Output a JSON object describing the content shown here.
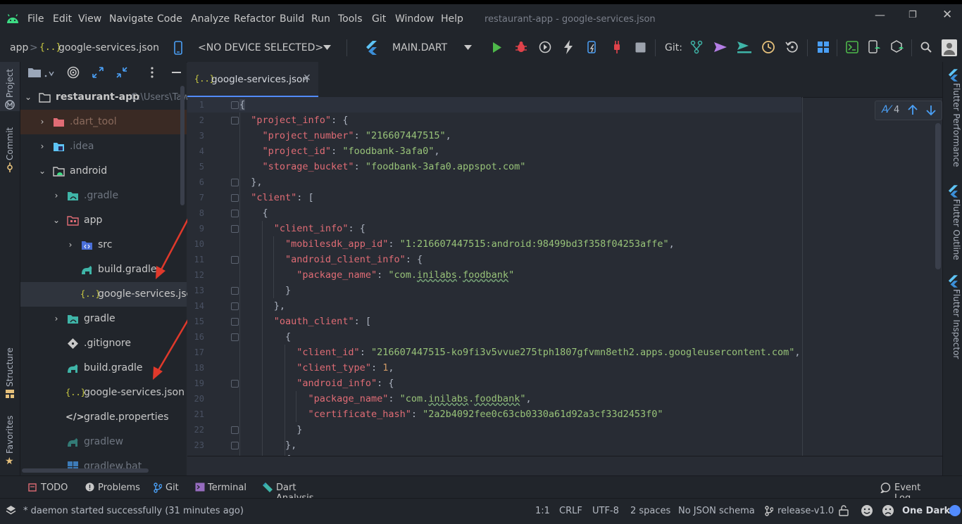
{
  "titlebar": {
    "menu": [
      "File",
      "Edit",
      "View",
      "Navigate",
      "Code",
      "Analyze",
      "Refactor",
      "Build",
      "Run",
      "Tools",
      "Git",
      "Window",
      "Help"
    ],
    "window_title": "restaurant-app - google-services.json"
  },
  "toolbar": {
    "breadcrumb_app": "app",
    "breadcrumb_sep": ">",
    "breadcrumb_file": "google-services.json",
    "json_icon": "{..}",
    "device": "<NO DEVICE SELECTED>",
    "run_config": "MAIN.DART",
    "git_label": "Git:"
  },
  "left_strip": {
    "project": "Project",
    "commit": "Commit",
    "structure": "Structure",
    "favorites": "Favorites"
  },
  "project_tree": {
    "root": "restaurant-app",
    "root_path": "C:\\Users\\Taw",
    "items": [
      {
        "label": "restaurant-app"
      },
      {
        "label": ".dart_tool"
      },
      {
        "label": ".idea"
      },
      {
        "label": "android"
      },
      {
        "label": ".gradle"
      },
      {
        "label": "app"
      },
      {
        "label": "src"
      },
      {
        "label": "build.gradle"
      },
      {
        "label": "google-services.json"
      },
      {
        "label": "gradle"
      },
      {
        "label": ".gitignore"
      },
      {
        "label": "build.gradle"
      },
      {
        "label": "google-services.json"
      },
      {
        "label": "gradle.properties"
      },
      {
        "label": "gradlew"
      },
      {
        "label": "gradlew.bat"
      }
    ]
  },
  "editor": {
    "tab_label": "google-services.json",
    "tab_icon": "{..}",
    "inspection_count": "4",
    "line_numbers": [
      "1",
      "2",
      "3",
      "4",
      "5",
      "6",
      "7",
      "8",
      "9",
      "10",
      "11",
      "12",
      "13",
      "14",
      "15",
      "16",
      "17",
      "18",
      "19",
      "20",
      "21",
      "22",
      "23"
    ]
  },
  "code": {
    "project_info": "\"project_info\"",
    "project_number_key": "\"project_number\"",
    "project_number_val": "\"216607447515\"",
    "project_id_key": "\"project_id\"",
    "project_id_val": "\"foodbank-3afa0\"",
    "storage_bucket_key": "\"storage_bucket\"",
    "storage_bucket_val": "\"foodbank-3afa0.appspot.com\"",
    "client": "\"client\"",
    "client_info": "\"client_info\"",
    "mobilesdk_key": "\"mobilesdk_app_id\"",
    "mobilesdk_val": "\"1:216607447515:android:98499bd3f358f04253affe\"",
    "android_client_info": "\"android_client_info\"",
    "package_name_key": "\"package_name\"",
    "pkg_prefix": "\"com.",
    "pkg_mid": "inilabs",
    "pkg_dot": ".",
    "pkg_end": "foodbank",
    "pkg_close": "\"",
    "oauth_client": "\"oauth_client\"",
    "client_id_key": "\"client_id\"",
    "client_id_val": "\"216607447515-ko9fi3v5vvue275tph1807gfvmn8eth2.apps.googleusercontent.com\"",
    "client_type_key": "\"client_type\"",
    "client_type_val": "1",
    "android_info": "\"android_info\"",
    "certificate_hash_key": "\"certificate_hash\"",
    "certificate_hash_val": "\"2a2b4092fee0c63cb0330a61d92a3cf33d2453f0\""
  },
  "right_strip": {
    "perf": "Flutter Performance",
    "outline": "Flutter Outline",
    "inspector": "Flutter Inspector"
  },
  "bottom_tools": {
    "todo": "TODO",
    "problems": "Problems",
    "git": "Git",
    "terminal": "Terminal",
    "dart": "Dart Analysis",
    "event_log": "Event Log"
  },
  "status_bar": {
    "message": "* daemon started successfully (31 minutes ago)",
    "position": "1:1",
    "line_sep": "CRLF",
    "encoding": "UTF-8",
    "indent": "2 spaces",
    "schema": "No JSON schema",
    "branch": "release-v1.0",
    "theme": "One Dark"
  },
  "colors": {
    "accent": "#528bff",
    "arrow": "#e0392b",
    "key": "#e06c75",
    "string": "#98c379",
    "number": "#d19a66"
  }
}
